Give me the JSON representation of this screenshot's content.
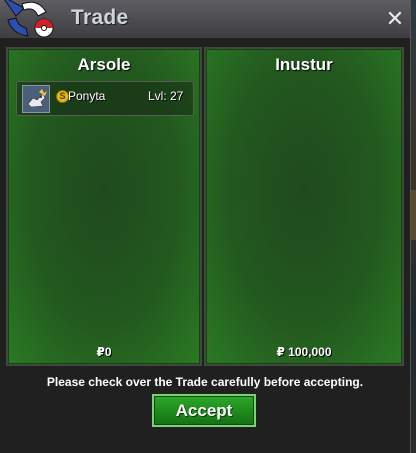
{
  "window": {
    "title": "Trade",
    "close_glyph": "✕"
  },
  "left_panel": {
    "player_name": "Arsole",
    "items": [
      {
        "icon": "pokemon-sprite-icon",
        "badge": "S",
        "name": "Ponyta",
        "level": "Lvl: 27"
      }
    ],
    "money": "₽0"
  },
  "right_panel": {
    "player_name": "Inustur",
    "items": [],
    "money": "₽ 100,000"
  },
  "footer": {
    "message": "Please check over the Trade carefully before accepting.",
    "accept_label": "Accept"
  },
  "colors": {
    "panel_green": "#23591f",
    "accept_green": "#1e8a1c",
    "coin_gold": "#e0b81a"
  }
}
